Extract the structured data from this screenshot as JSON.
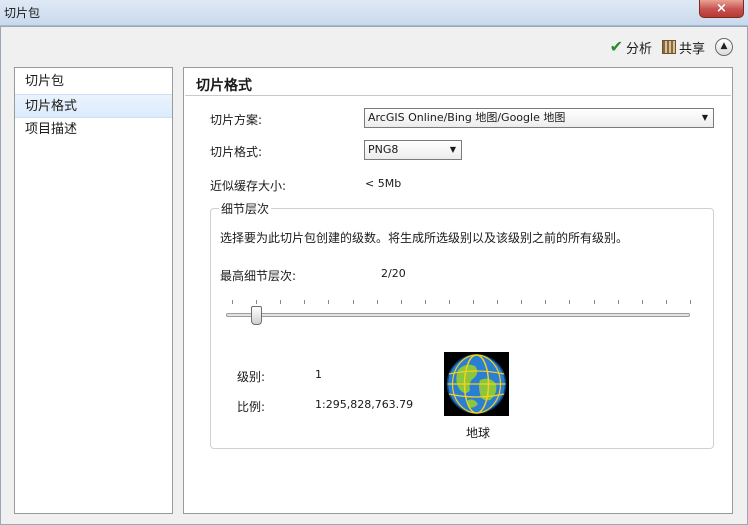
{
  "window": {
    "title": "切片包",
    "close_label": "×"
  },
  "toolbar": {
    "analyze_label": "分析",
    "share_label": "共享",
    "collapse_glyph": "▲"
  },
  "sidebar": {
    "items": [
      {
        "label": "切片包"
      },
      {
        "label": "切片格式"
      },
      {
        "label": "项目描述"
      }
    ]
  },
  "main": {
    "title": "切片格式",
    "tiling_scheme_label": "切片方案:",
    "tiling_scheme_value": "ArcGIS Online/Bing 地图/Google 地图",
    "tile_format_label": "切片格式:",
    "tile_format_value": "PNG8",
    "cache_size_label": "近似缓存大小:",
    "cache_size_value": "< 5Mb",
    "lod": {
      "legend": "细节层次",
      "description": "选择要为此切片包创建的级数。将生成所选级别以及该级别之前的所有级别。",
      "max_label": "最高细节层次:",
      "max_value": "2/20",
      "slider_level": 2,
      "slider_max": 20,
      "level_label": "级别:",
      "level_value": "1",
      "scale_label": "比例:",
      "scale_value": "1:295,828,763.79",
      "preview_caption": "地球"
    }
  },
  "colors": {
    "ocean": "#2a7fd4",
    "land": "#8cc63f",
    "grid": "#f2d21b"
  },
  "icons": {
    "analyze": "check-icon",
    "share": "share-icon",
    "collapse": "chevron-up-icon",
    "preview": "globe-icon",
    "dropdown": "chevron-down-icon"
  }
}
